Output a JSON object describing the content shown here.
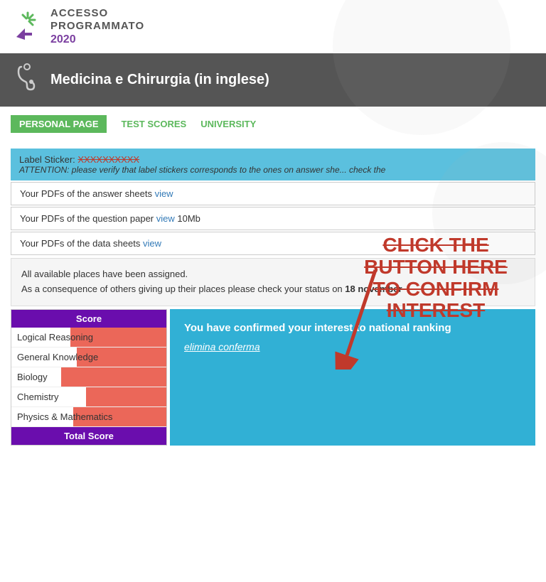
{
  "logo": {
    "accesso": "ACCESSO",
    "programmato": "PROGRAMMATO",
    "year": "2020"
  },
  "program_banner": {
    "title": "Medicina e Chirurgia (in inglese)",
    "stethoscope": "⚕"
  },
  "nav": {
    "personal_page": "PERSONAL PAGE",
    "test_scores": "TEST SCORES",
    "university": "UNIVERSITY"
  },
  "label_sticker": {
    "label": "Label Sticker:",
    "value": "XXXXXXXXXX",
    "attention": "ATTENTION: please verify that label stickers corresponds to the ones on answer she... check the"
  },
  "pdf_rows": [
    {
      "text": "Your PDFs of the answer sheets",
      "link": "view",
      "extra": ""
    },
    {
      "text": "Your PDFs of the question paper",
      "link": "view",
      "extra": " 10Mb"
    },
    {
      "text": "Your PDFs of the data sheets",
      "link": "view",
      "extra": ""
    }
  ],
  "status_box": {
    "line1": "All available places have been assigned.",
    "line2": "As a consequence of others giving up their places please check your status on",
    "date": "18 november"
  },
  "score_table": {
    "header": "Score",
    "rows": [
      {
        "label": "Logical Reasoning",
        "bar_pct": 60
      },
      {
        "label": "General Knowledge",
        "bar_pct": 55
      },
      {
        "label": "Biology",
        "bar_pct": 65
      },
      {
        "label": "Chemistry",
        "bar_pct": 50
      },
      {
        "label": "Physics & Mathematics",
        "bar_pct": 58
      }
    ],
    "total": "Total Score"
  },
  "confirm_box": {
    "title": "You have confirmed your interest to national ranking",
    "elimina_link": "elimina conferma"
  },
  "annotation": {
    "line1": "CLICK THE",
    "line2": "BUTTON HERE",
    "line3": "TO CONFIRM",
    "line4": "INTEREST"
  }
}
